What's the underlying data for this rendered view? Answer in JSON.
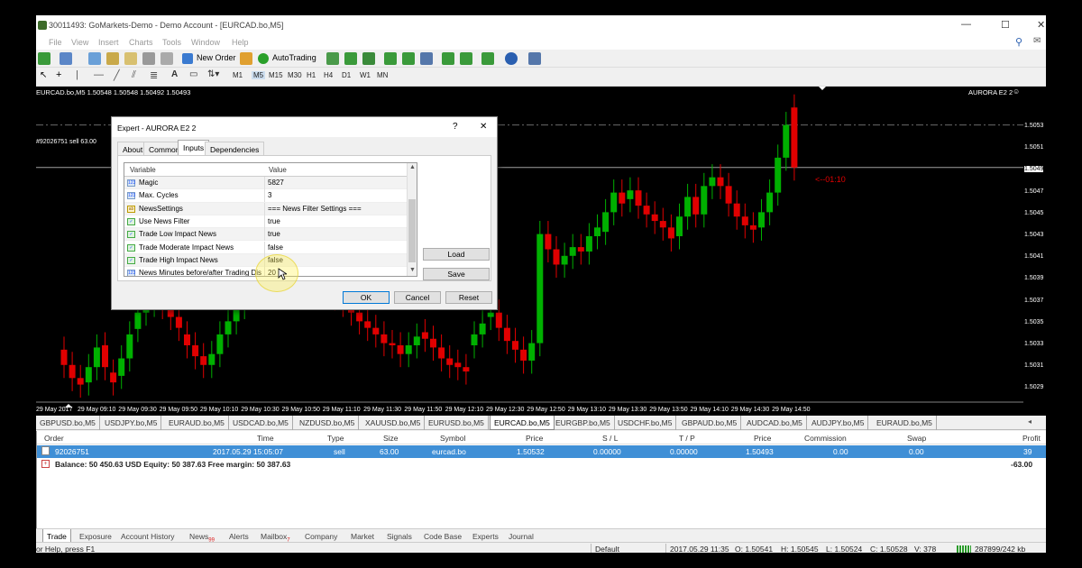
{
  "window": {
    "title": "30011493: GoMarkets-Demo - Demo Account - [EURCAD.bo,M5]",
    "controls": [
      "—",
      "☐",
      "✕"
    ]
  },
  "menu": [
    "File",
    "View",
    "Insert",
    "Charts",
    "Tools",
    "Window",
    "Help"
  ],
  "toolbar": {
    "new_order": "New Order",
    "autotrading": "AutoTrading",
    "timeframes": [
      "M1",
      "M5",
      "M15",
      "M30",
      "H1",
      "H4",
      "D1",
      "W1",
      "MN"
    ]
  },
  "chart": {
    "header": "EURCAD.bo,M5  1.50548 1.50548 1.50492 1.50493",
    "ea_label": "AURORA E2 2",
    "order_label": "#92026751 sell 63.00",
    "countdown": "<--01:10",
    "current_price": "1.5049",
    "price_ticks": [
      "1.5053",
      "1.5051",
      "1.5049",
      "1.5047",
      "1.5045",
      "1.5043",
      "1.5041",
      "1.5039",
      "1.5037",
      "1.5035",
      "1.5033",
      "1.5031",
      "1.5029"
    ],
    "time_ticks": [
      "29 May 2017",
      "29 May 09:10",
      "29 May 09:30",
      "29 May 09:50",
      "29 May 10:10",
      "29 May 10:30",
      "29 May 10:50",
      "29 May 11:10",
      "29 May 11:30",
      "29 May 11:50",
      "29 May 12:10",
      "29 May 12:30",
      "29 May 12:50",
      "29 May 13:10",
      "29 May 13:30",
      "29 May 13:50",
      "29 May 14:10",
      "29 May 14:30",
      "29 May 14:50"
    ],
    "colors": {
      "bull": "#00b000",
      "bear": "#e00000",
      "bg": "#000000",
      "order_line": "#7a7a7a"
    }
  },
  "symbol_tabs": [
    "GBPUSD.bo,M5",
    "USDJPY.bo,M5",
    "EURAUD.bo,M5",
    "USDCAD.bo,M5",
    "NZDUSD.bo,M5",
    "XAUUSD.bo,M5",
    "EURUSD.bo,M5",
    "EURCAD.bo,M5",
    "EURGBP.bo,M5",
    "USDCHF.bo,M5",
    "GBPAUD.bo,M5",
    "AUDCAD.bo,M5",
    "AUDJPY.bo,M5",
    "EURAUD.bo,M5"
  ],
  "active_symbol_tab": "EURCAD.bo,M5",
  "dialog": {
    "title": "Expert - AURORA E2 2",
    "help": "?",
    "close": "✕",
    "tabs": [
      "About",
      "Common",
      "Inputs",
      "Dependencies"
    ],
    "active_tab": "Inputs",
    "columns": [
      "Variable",
      "Value"
    ],
    "params": [
      {
        "icon": "123",
        "name": "Magic",
        "value": "5827"
      },
      {
        "icon": "123",
        "name": "Max. Cycles",
        "value": "3"
      },
      {
        "icon": "ab",
        "name": "NewsSettings",
        "value": "=== News Filter Settings ==="
      },
      {
        "icon": "bool",
        "name": "Use News Filter",
        "value": "true"
      },
      {
        "icon": "bool",
        "name": "Trade Low Impact News",
        "value": "true"
      },
      {
        "icon": "bool",
        "name": "Trade Moderate Impact News",
        "value": "false"
      },
      {
        "icon": "bool",
        "name": "Trade High Impact News",
        "value": "false"
      },
      {
        "icon": "123",
        "name": "News Minutes before/after Trading Dis...",
        "value": "20"
      }
    ],
    "buttons": {
      "load": "Load",
      "save": "Save",
      "ok": "OK",
      "cancel": "Cancel",
      "reset": "Reset"
    }
  },
  "terminal": {
    "headers": [
      "Order",
      "Time",
      "Type",
      "Size",
      "Symbol",
      "Price",
      "S / L",
      "T / P",
      "Price",
      "Commission",
      "Swap",
      "Profit"
    ],
    "order": {
      "order": "92026751",
      "time": "2017.05.29 15:05:07",
      "type": "sell",
      "size": "63.00",
      "symbol": "eurcad.bo",
      "price": "1.50532",
      "sl": "0.00000",
      "tp": "0.00000",
      "cur_price": "1.50493",
      "commission": "0.00",
      "swap": "0.00",
      "profit": "39"
    },
    "balance_line": "Balance: 50 450.63 USD  Equity: 50 387.63  Free margin: 50 387.63",
    "balance_profit": "-63.00",
    "tabs": [
      {
        "label": "Trade",
        "badge": ""
      },
      {
        "label": "Exposure",
        "badge": ""
      },
      {
        "label": "Account History",
        "badge": ""
      },
      {
        "label": "News",
        "badge": "99"
      },
      {
        "label": "Alerts",
        "badge": ""
      },
      {
        "label": "Mailbox",
        "badge": "7"
      },
      {
        "label": "Company",
        "badge": ""
      },
      {
        "label": "Market",
        "badge": ""
      },
      {
        "label": "Signals",
        "badge": ""
      },
      {
        "label": "Code Base",
        "badge": ""
      },
      {
        "label": "Experts",
        "badge": ""
      },
      {
        "label": "Journal",
        "badge": ""
      }
    ],
    "active_tab": "Trade"
  },
  "status": {
    "help": "or Help, press F1",
    "profile": "Default",
    "datetime": "2017.05.29 11:35",
    "open": "O: 1.50541",
    "high": "H: 1.50545",
    "low": "L: 1.50524",
    "close": "C: 1.50528",
    "volume": "V: 378",
    "traffic": "287899/242 kb"
  },
  "candles": [
    {
      "o": 1.50322,
      "h": 1.50338,
      "l": 1.50296,
      "c": 1.5031
    },
    {
      "o": 1.5031,
      "h": 1.5033,
      "l": 1.5029,
      "c": 1.50304
    },
    {
      "o": 1.50304,
      "h": 1.5032,
      "l": 1.5028,
      "c": 1.50294
    },
    {
      "o": 1.50296,
      "h": 1.50316,
      "l": 1.50286,
      "c": 1.5031
    },
    {
      "o": 1.5031,
      "h": 1.50348,
      "l": 1.50298,
      "c": 1.5033
    },
    {
      "o": 1.5033,
      "h": 1.50346,
      "l": 1.5029,
      "c": 1.503
    },
    {
      "o": 1.503,
      "h": 1.50312,
      "l": 1.50286,
      "c": 1.50302
    },
    {
      "o": 1.50302,
      "h": 1.50322,
      "l": 1.5029,
      "c": 1.50312
    },
    {
      "o": 1.50312,
      "h": 1.50338,
      "l": 1.503,
      "c": 1.50326
    }
  ]
}
